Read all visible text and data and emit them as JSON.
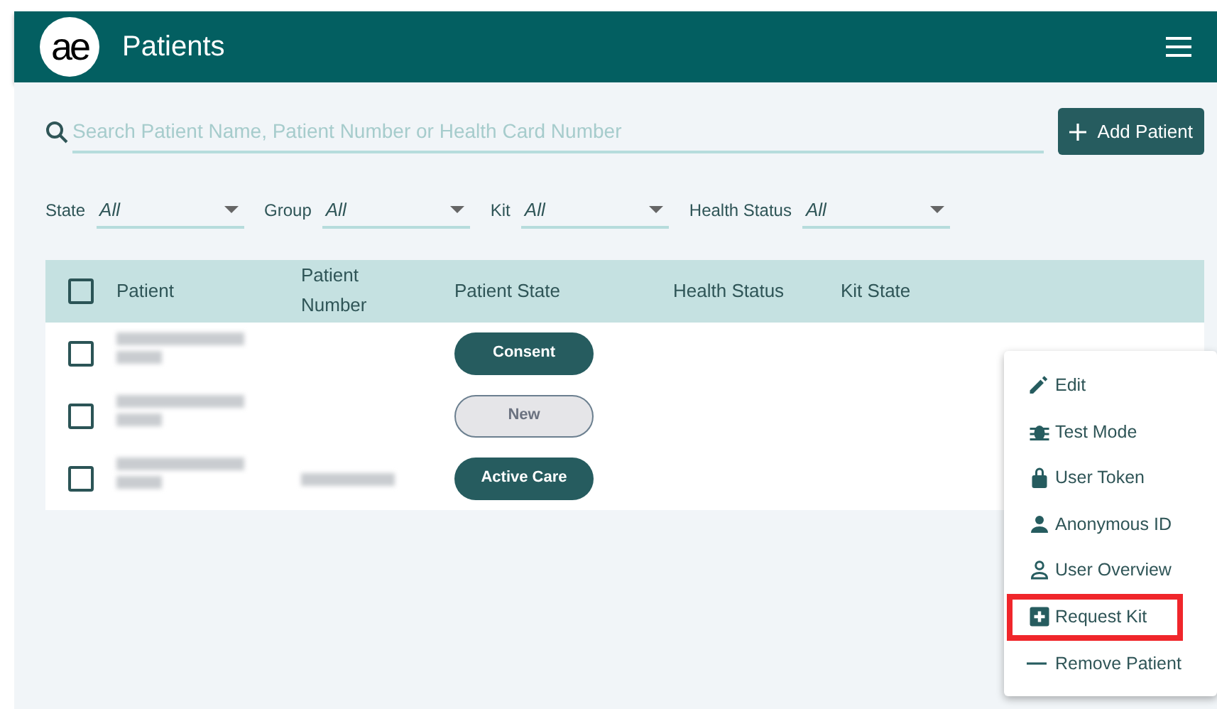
{
  "header": {
    "logo": "ae",
    "title": "Patients"
  },
  "search": {
    "placeholder": "Search Patient Name, Patient Number or Health Card Number"
  },
  "add_button": {
    "label": "Add Patient"
  },
  "filters": [
    {
      "label": "State",
      "value": "All"
    },
    {
      "label": "Group",
      "value": "All"
    },
    {
      "label": "Kit",
      "value": "All"
    },
    {
      "label": "Health Status",
      "value": "All"
    }
  ],
  "table": {
    "header_checked": false,
    "columns": [
      "Patient",
      "Patient Number",
      "Patient State",
      "Health Status",
      "Kit State"
    ],
    "rows": [
      {
        "checked": false,
        "name_redacted": true,
        "number_redacted": false,
        "state": {
          "label": "Consent",
          "kind": "filled"
        }
      },
      {
        "checked": false,
        "name_redacted": true,
        "number_redacted": false,
        "state": {
          "label": "New",
          "kind": "outline"
        }
      },
      {
        "checked": false,
        "name_redacted": true,
        "number_redacted": true,
        "state": {
          "label": "Active Care",
          "kind": "filled"
        }
      }
    ]
  },
  "menu": [
    {
      "label": "Edit",
      "kind": "pencil",
      "highlighted": false
    },
    {
      "label": "Test Mode",
      "kind": "bug",
      "highlighted": false
    },
    {
      "label": "User Token",
      "kind": "lock",
      "highlighted": false
    },
    {
      "label": "Anonymous ID",
      "kind": "person",
      "highlighted": false
    },
    {
      "label": "User Overview",
      "kind": "person-outline",
      "highlighted": false
    },
    {
      "label": "Request Kit",
      "kind": "plus-square",
      "highlighted": true
    },
    {
      "label": "Remove Patient",
      "kind": "minus",
      "highlighted": false
    }
  ]
}
